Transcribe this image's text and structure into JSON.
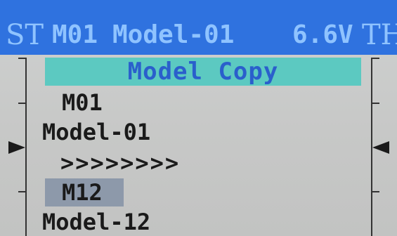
{
  "status_bar": {
    "left_channel": "ST",
    "model_id": "M01",
    "model_name": "Model-01",
    "voltage": "6.6V",
    "right_channel": "TH"
  },
  "menu": {
    "title": "Model Copy"
  },
  "copy": {
    "source_id": "M01",
    "source_name": "Model-01",
    "direction": ">>>>>>>>",
    "target_id": "M12",
    "target_name": "Model-12"
  },
  "colors": {
    "status_bar_bg": "#2f72df",
    "status_bar_text": "#8fc3ff",
    "title_bg": "#5cc9c1",
    "title_text": "#2a5fcc",
    "selection_bg": "#8d99aa",
    "screen_bg": "#c9c9c9"
  },
  "icons": {
    "left_trim_marker": "triangle-right-icon",
    "right_trim_marker": "triangle-left-icon"
  }
}
